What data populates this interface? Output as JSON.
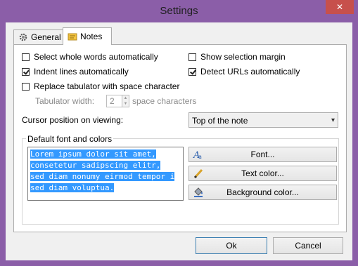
{
  "window": {
    "title": "Settings",
    "close_glyph": "✕"
  },
  "tabs": [
    {
      "label": "General",
      "icon": "gear-icon"
    },
    {
      "label": "Notes",
      "icon": "notes-icon"
    }
  ],
  "options": {
    "select_whole_words": {
      "label": "Select whole words automatically",
      "checked": false
    },
    "indent_lines": {
      "label": "Indent lines automatically",
      "checked": true
    },
    "replace_tab": {
      "label": "Replace tabulator with space character",
      "checked": false
    },
    "show_margin": {
      "label": "Show selection margin",
      "checked": false
    },
    "detect_urls": {
      "label": "Detect URLs automatically",
      "checked": true
    }
  },
  "tab_width": {
    "label": "Tabulator width:",
    "value": "2",
    "suffix": "space characters"
  },
  "cursor": {
    "label": "Cursor position on viewing:",
    "value": "Top of the note"
  },
  "font_group": {
    "label": "Default font and colors",
    "preview_lines": [
      "Lorem ipsum dolor sit amet,",
      "consetetur sadipscing elitr,",
      "sed diam nonumy eirmod tempor i",
      "sed diam voluptua."
    ],
    "font_button": "Font...",
    "text_color_button": "Text color...",
    "background_color_button": "Background color..."
  },
  "footer": {
    "ok": "Ok",
    "cancel": "Cancel"
  },
  "colors": {
    "frame": "#8b5ea8",
    "close": "#c7504c",
    "selection": "#3399ff"
  }
}
